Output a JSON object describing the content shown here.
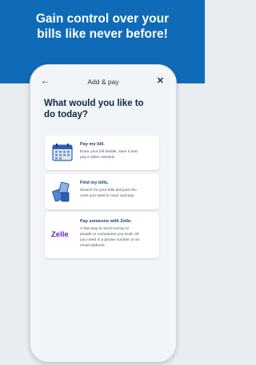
{
  "hero": {
    "title_line1": "Gain control over your",
    "title_line2": "bills like never before!"
  },
  "nav": {
    "back_icon": "←",
    "title": "Add & pay",
    "close_icon": "✕"
  },
  "heading": {
    "line1": "What would you like to",
    "line2": "do today?"
  },
  "options": [
    {
      "title": "Pay my bill.",
      "desc_line1": "Enter your bill details, save it and",
      "desc_line2": "pay it when needed.",
      "icon": "calendar-icon"
    },
    {
      "title": "Find my bills.",
      "desc_line1": "Search for your bills and pick the",
      "desc_line2": "ones you want to save and pay.",
      "icon": "bills-icon"
    },
    {
      "title": "Pay someone with Zelle.",
      "desc_line1": "A fast way to send money to",
      "desc_line2": "people or companies you trust. All",
      "desc_line3": "you need is a phone number or an",
      "desc_line4": "email address.",
      "logo": "Zelle"
    }
  ],
  "colors": {
    "brand_blue": "#0f6bb7",
    "zelle_purple": "#6d1ed4"
  }
}
